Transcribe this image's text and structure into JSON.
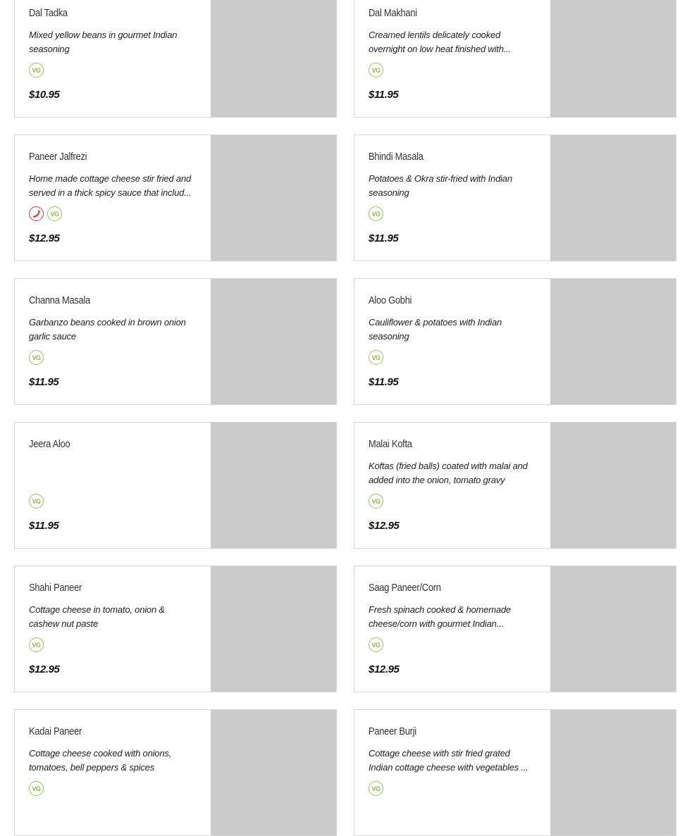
{
  "menu": {
    "items": [
      {
        "name": "Dal Tadka",
        "description": "Mixed yellow beans in gourmet Indian seasoning",
        "price": "$10.95",
        "badges": [
          "VG"
        ]
      },
      {
        "name": "Dal Makhani",
        "description": "Creamed lentils delicately cooked overnight on low heat finished with...",
        "price": "$11.95",
        "badges": [
          "VG"
        ]
      },
      {
        "name": "Paneer Jalfrezi",
        "description": "Home made cottage cheese stir fried and served in a thick spicy sauce that includ...",
        "price": "$12.95",
        "badges": [
          "spicy",
          "VG"
        ]
      },
      {
        "name": "Bhindi Masala",
        "description": "Potatoes & Okra stir-fried with Indian seasoning",
        "price": "$11.95",
        "badges": [
          "VG"
        ]
      },
      {
        "name": "Channa Masala",
        "description": "Garbanzo beans cooked in brown onion garlic sauce",
        "price": "$11.95",
        "badges": [
          "VG"
        ]
      },
      {
        "name": "Aloo Gobhi",
        "description": "Cauliflower & potatoes with Indian seasoning",
        "price": "$11.95",
        "badges": [
          "VG"
        ]
      },
      {
        "name": "Jeera Aloo",
        "description": "",
        "price": "$11.95",
        "badges": [
          "VG"
        ]
      },
      {
        "name": "Malai Kofta",
        "description": "Koftas (fried balls) coated with malai and added into the onion, tomato gravy",
        "price": "$12.95",
        "badges": [
          "VG"
        ]
      },
      {
        "name": "Shahi Paneer",
        "description": "Cottage cheese in tomato, onion & cashew nut paste",
        "price": "$12.95",
        "badges": [
          "VG"
        ]
      },
      {
        "name": "Saag Paneer/Corn",
        "description": "Fresh spinach cooked & homemade cheese/corn with gourmet Indian...",
        "price": "$12.95",
        "badges": [
          "VG"
        ]
      },
      {
        "name": "Kadai Paneer",
        "description": "Cottage cheese cooked with onions, tomatoes, bell peppers & spices",
        "price": "",
        "badges": [
          "VG"
        ]
      },
      {
        "name": "Paneer Burji",
        "description": "Cottage cheese with stir fried grated Indian cottage cheese with vegetables ...",
        "price": "",
        "badges": [
          "VG"
        ]
      }
    ]
  },
  "colors": {
    "vg_badge": "#9cc35a",
    "spicy_badge": "#d43a3a",
    "image_placeholder": "#cbcbcb",
    "card_border": "#d6d6d6"
  },
  "icons": {
    "VG": "vegetarian-icon",
    "spicy": "chili-pepper-icon"
  }
}
